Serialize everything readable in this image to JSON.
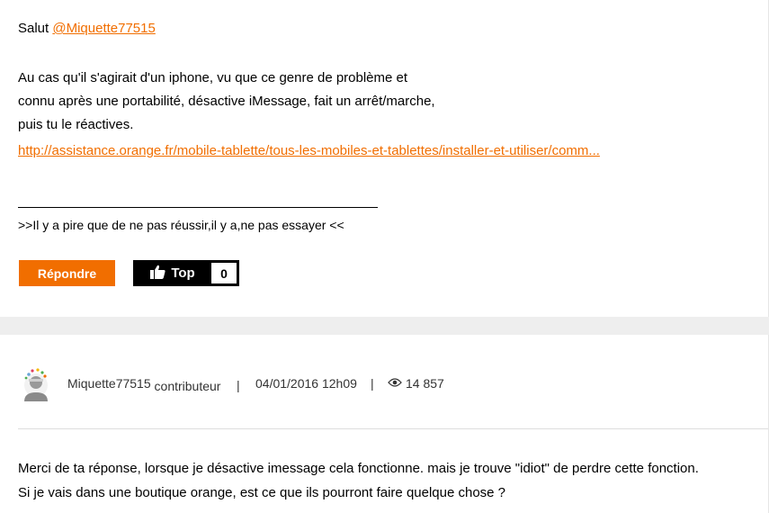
{
  "post1": {
    "greeting": "Salut ",
    "mention": "@Miquette77515",
    "body_lines": [
      "Au cas qu'il s'agirait d'un iphone, vu que ce genre de problème et",
      "connu après une portabilité, désactive iMessage, fait un arrêt/marche,",
      "puis tu le réactives."
    ],
    "link_text": "http://assistance.orange.fr/mobile-tablette/tous-les-mobiles-et-tablettes/installer-et-utiliser/comm...",
    "signature": ">>Il y a pire que de ne pas réussir,il y a,ne pas essayer <<",
    "reply_label": "Répondre",
    "top_label": "Top",
    "top_count": "0"
  },
  "post2": {
    "author": "Miquette77515",
    "role": "contributeur",
    "pipe": "|",
    "date": "04/01/2016 12h09",
    "views": "14 857",
    "body_lines": [
      "Merci de ta réponse, lorsque je désactive imessage cela fonctionne. mais je trouve \"idiot\" de perdre cette fonction.",
      "Si je vais dans une boutique orange, est ce que ils pourront faire quelque chose ?"
    ]
  },
  "colors": {
    "accent": "#f16e00",
    "separator": "#eeeeee"
  },
  "icons": {
    "thumbs_up": "thumbs-up-icon",
    "eye": "eye-icon",
    "avatar": "avatar-icon"
  }
}
